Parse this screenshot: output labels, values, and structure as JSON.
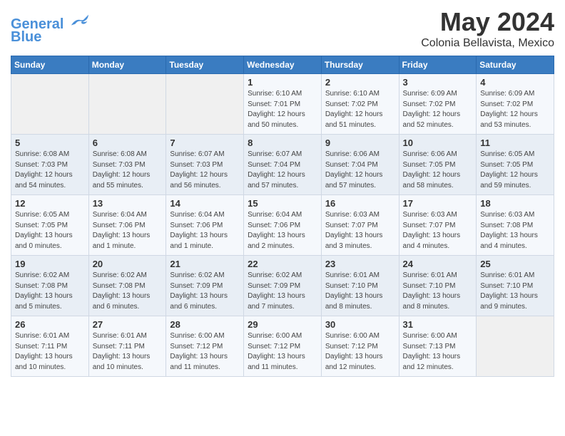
{
  "header": {
    "logo_line1": "General",
    "logo_line2": "Blue",
    "month_title": "May 2024",
    "location": "Colonia Bellavista, Mexico"
  },
  "weekdays": [
    "Sunday",
    "Monday",
    "Tuesday",
    "Wednesday",
    "Thursday",
    "Friday",
    "Saturday"
  ],
  "weeks": [
    [
      {
        "day": "",
        "info": ""
      },
      {
        "day": "",
        "info": ""
      },
      {
        "day": "",
        "info": ""
      },
      {
        "day": "1",
        "info": "Sunrise: 6:10 AM\nSunset: 7:01 PM\nDaylight: 12 hours\nand 50 minutes."
      },
      {
        "day": "2",
        "info": "Sunrise: 6:10 AM\nSunset: 7:02 PM\nDaylight: 12 hours\nand 51 minutes."
      },
      {
        "day": "3",
        "info": "Sunrise: 6:09 AM\nSunset: 7:02 PM\nDaylight: 12 hours\nand 52 minutes."
      },
      {
        "day": "4",
        "info": "Sunrise: 6:09 AM\nSunset: 7:02 PM\nDaylight: 12 hours\nand 53 minutes."
      }
    ],
    [
      {
        "day": "5",
        "info": "Sunrise: 6:08 AM\nSunset: 7:03 PM\nDaylight: 12 hours\nand 54 minutes."
      },
      {
        "day": "6",
        "info": "Sunrise: 6:08 AM\nSunset: 7:03 PM\nDaylight: 12 hours\nand 55 minutes."
      },
      {
        "day": "7",
        "info": "Sunrise: 6:07 AM\nSunset: 7:03 PM\nDaylight: 12 hours\nand 56 minutes."
      },
      {
        "day": "8",
        "info": "Sunrise: 6:07 AM\nSunset: 7:04 PM\nDaylight: 12 hours\nand 57 minutes."
      },
      {
        "day": "9",
        "info": "Sunrise: 6:06 AM\nSunset: 7:04 PM\nDaylight: 12 hours\nand 57 minutes."
      },
      {
        "day": "10",
        "info": "Sunrise: 6:06 AM\nSunset: 7:05 PM\nDaylight: 12 hours\nand 58 minutes."
      },
      {
        "day": "11",
        "info": "Sunrise: 6:05 AM\nSunset: 7:05 PM\nDaylight: 12 hours\nand 59 minutes."
      }
    ],
    [
      {
        "day": "12",
        "info": "Sunrise: 6:05 AM\nSunset: 7:05 PM\nDaylight: 13 hours\nand 0 minutes."
      },
      {
        "day": "13",
        "info": "Sunrise: 6:04 AM\nSunset: 7:06 PM\nDaylight: 13 hours\nand 1 minute."
      },
      {
        "day": "14",
        "info": "Sunrise: 6:04 AM\nSunset: 7:06 PM\nDaylight: 13 hours\nand 1 minute."
      },
      {
        "day": "15",
        "info": "Sunrise: 6:04 AM\nSunset: 7:06 PM\nDaylight: 13 hours\nand 2 minutes."
      },
      {
        "day": "16",
        "info": "Sunrise: 6:03 AM\nSunset: 7:07 PM\nDaylight: 13 hours\nand 3 minutes."
      },
      {
        "day": "17",
        "info": "Sunrise: 6:03 AM\nSunset: 7:07 PM\nDaylight: 13 hours\nand 4 minutes."
      },
      {
        "day": "18",
        "info": "Sunrise: 6:03 AM\nSunset: 7:08 PM\nDaylight: 13 hours\nand 4 minutes."
      }
    ],
    [
      {
        "day": "19",
        "info": "Sunrise: 6:02 AM\nSunset: 7:08 PM\nDaylight: 13 hours\nand 5 minutes."
      },
      {
        "day": "20",
        "info": "Sunrise: 6:02 AM\nSunset: 7:08 PM\nDaylight: 13 hours\nand 6 minutes."
      },
      {
        "day": "21",
        "info": "Sunrise: 6:02 AM\nSunset: 7:09 PM\nDaylight: 13 hours\nand 6 minutes."
      },
      {
        "day": "22",
        "info": "Sunrise: 6:02 AM\nSunset: 7:09 PM\nDaylight: 13 hours\nand 7 minutes."
      },
      {
        "day": "23",
        "info": "Sunrise: 6:01 AM\nSunset: 7:10 PM\nDaylight: 13 hours\nand 8 minutes."
      },
      {
        "day": "24",
        "info": "Sunrise: 6:01 AM\nSunset: 7:10 PM\nDaylight: 13 hours\nand 8 minutes."
      },
      {
        "day": "25",
        "info": "Sunrise: 6:01 AM\nSunset: 7:10 PM\nDaylight: 13 hours\nand 9 minutes."
      }
    ],
    [
      {
        "day": "26",
        "info": "Sunrise: 6:01 AM\nSunset: 7:11 PM\nDaylight: 13 hours\nand 10 minutes."
      },
      {
        "day": "27",
        "info": "Sunrise: 6:01 AM\nSunset: 7:11 PM\nDaylight: 13 hours\nand 10 minutes."
      },
      {
        "day": "28",
        "info": "Sunrise: 6:00 AM\nSunset: 7:12 PM\nDaylight: 13 hours\nand 11 minutes."
      },
      {
        "day": "29",
        "info": "Sunrise: 6:00 AM\nSunset: 7:12 PM\nDaylight: 13 hours\nand 11 minutes."
      },
      {
        "day": "30",
        "info": "Sunrise: 6:00 AM\nSunset: 7:12 PM\nDaylight: 13 hours\nand 12 minutes."
      },
      {
        "day": "31",
        "info": "Sunrise: 6:00 AM\nSunset: 7:13 PM\nDaylight: 13 hours\nand 12 minutes."
      },
      {
        "day": "",
        "info": ""
      }
    ]
  ]
}
